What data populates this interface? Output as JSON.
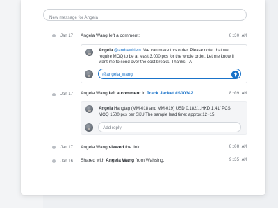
{
  "composer": {
    "placeholder": "New message for Angela"
  },
  "feed": [
    {
      "date": "Jan 17",
      "time": "8:30 AM",
      "actor": "Angela Wang",
      "action": "left a comment:",
      "comment": {
        "author": "Angela",
        "mention": "@andrewklein",
        "text": ". We can make this order. Please note, that we require MOQ to be at least 3,000 pcs for the whole order. Let me know if want me to send over the cost breaks. Thanks! -A"
      },
      "reply": {
        "value": "@angela_wang"
      }
    },
    {
      "date": "Jan 17",
      "time": "8:09 AM",
      "actor": "Angela Wang",
      "action": "left a comment",
      "link_prefix": "in",
      "link": "Track Jacket #S00342",
      "comment": {
        "author": "Angela",
        "text": "Hangtag (MM-018 and MM-019) USD 0.182/...HKD 1.41/ PCS MOQ 1500 pcs per SKU The sample lead time:  approx 12~15."
      },
      "reply": {
        "placeholder": "Add reply"
      }
    },
    {
      "date": "Jan 17",
      "time": "8:08 AM",
      "actor": "Angela Wang",
      "action_bold": "viewed",
      "action_tail": "the link."
    },
    {
      "date": "Jan 16",
      "time": "9:35 AM",
      "prefix": "Shared with",
      "actor": "Angela Wang",
      "suffix": "from Wahsing."
    }
  ],
  "colors": {
    "accent": "#1a73c9",
    "panel": "#ffffff",
    "background": "#eef0f3"
  }
}
